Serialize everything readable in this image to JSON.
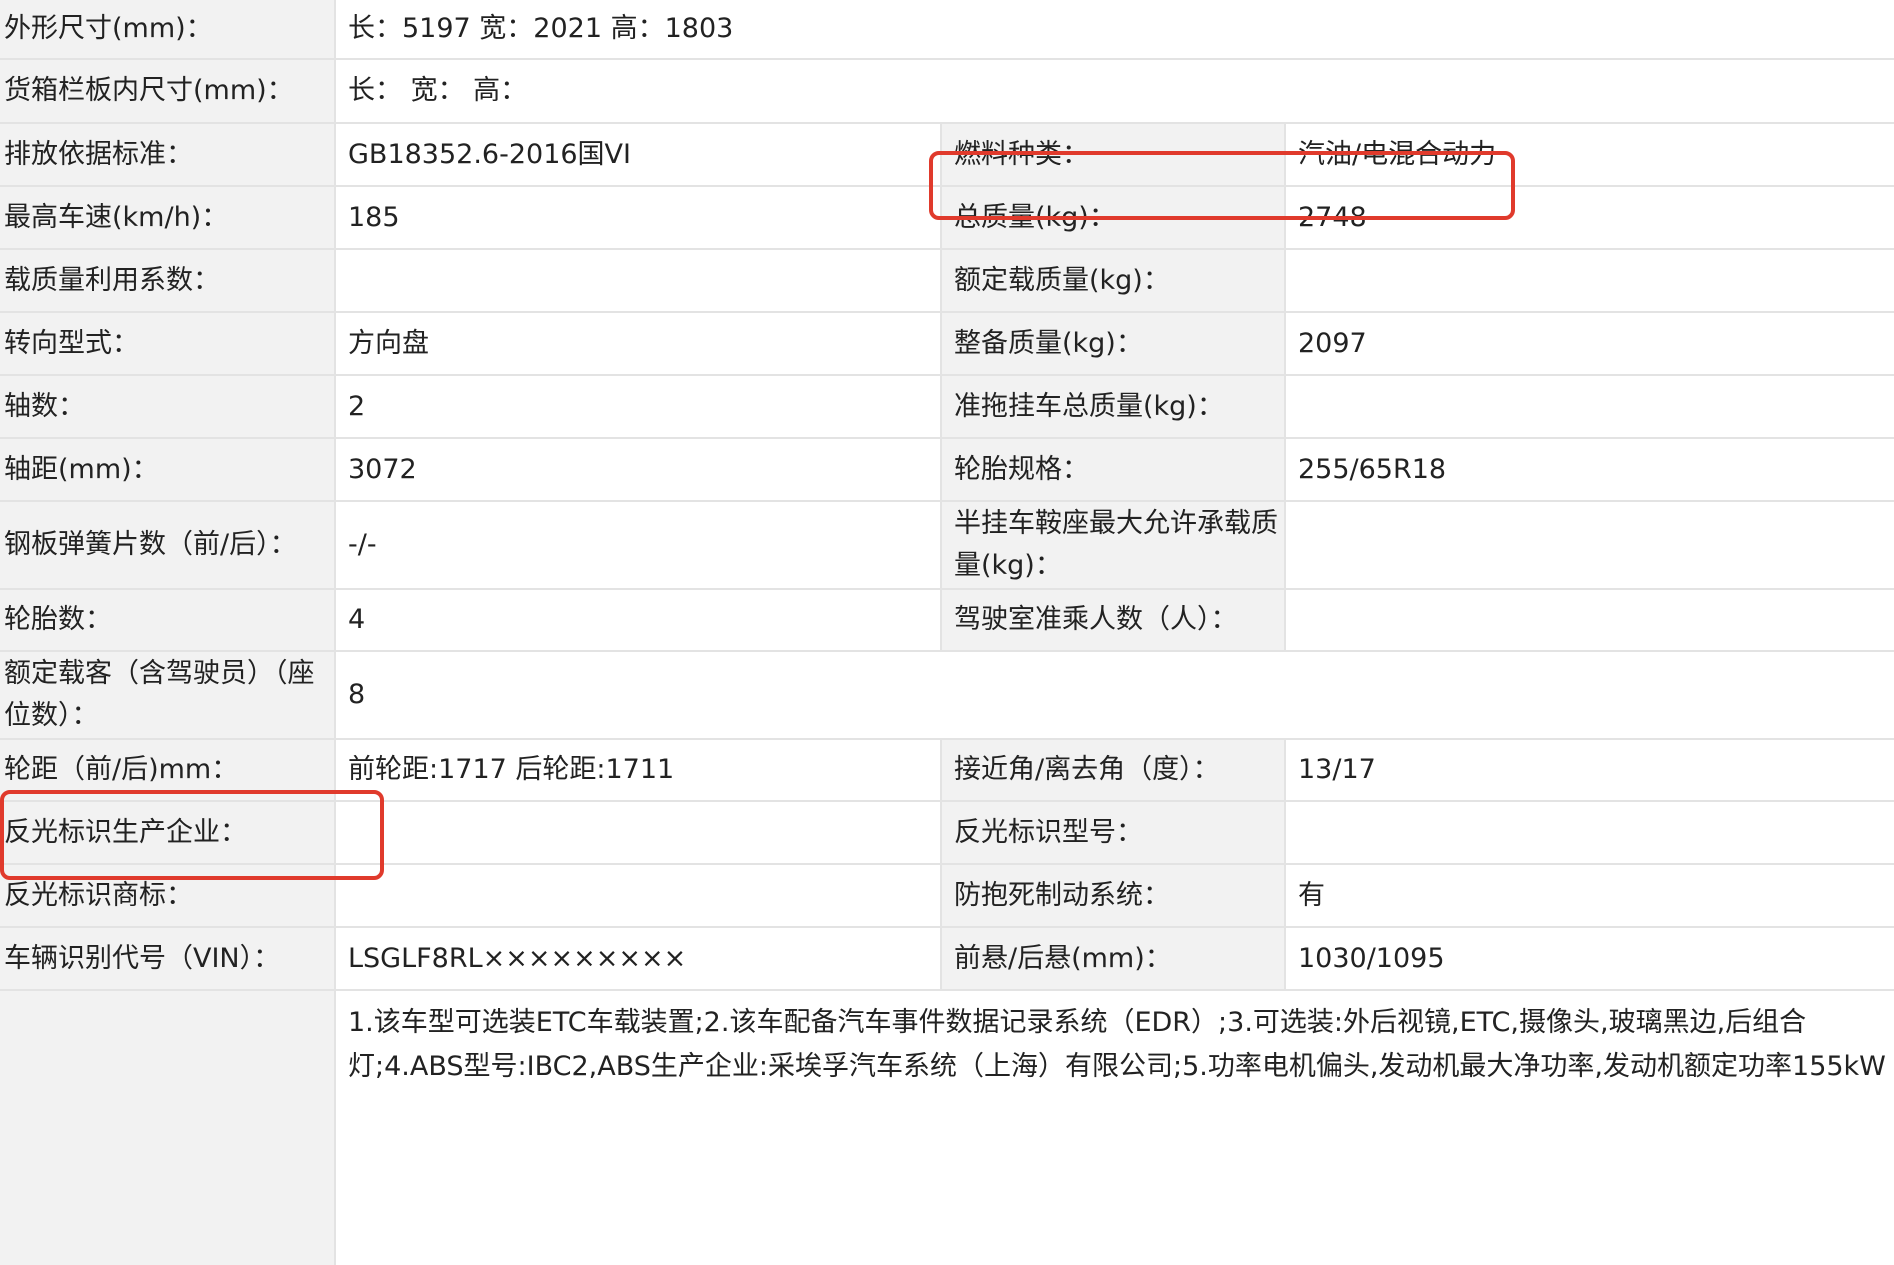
{
  "rows": [
    {
      "l1": "外形尺寸(mm)：",
      "v1": "长：5197 宽：2021 高：1803"
    },
    {
      "l1": "货箱栏板内尺寸(mm)：",
      "v1": "长：  宽：  高："
    },
    {
      "l1": "排放依据标准：",
      "v1": "GB18352.6-2016国VI",
      "l2": "燃料种类：",
      "v2": "汽油/电混合动力"
    },
    {
      "l1": "最高车速(km/h)：",
      "v1": "185",
      "l2": "总质量(kg)：",
      "v2": "2748"
    },
    {
      "l1": "载质量利用系数：",
      "v1": "",
      "l2": "额定载质量(kg)：",
      "v2": ""
    },
    {
      "l1": "转向型式：",
      "v1": "方向盘",
      "l2": "整备质量(kg)：",
      "v2": "2097"
    },
    {
      "l1": "轴数：",
      "v1": "2",
      "l2": "准拖挂车总质量(kg)：",
      "v2": ""
    },
    {
      "l1": "轴距(mm)：",
      "v1": "3072",
      "l2": "轮胎规格：",
      "v2": "255/65R18"
    },
    {
      "l1": "钢板弹簧片数（前/后）：",
      "v1": "-/-",
      "l2": "半挂车鞍座最大允许承载质量(kg)：",
      "v2": ""
    },
    {
      "l1": "轮胎数：",
      "v1": "4",
      "l2": "驾驶室准乘人数（人）：",
      "v2": ""
    },
    {
      "l1": "额定载客（含驾驶员）（座位数）：",
      "v1": "8"
    },
    {
      "l1": "轮距（前/后)mm：",
      "v1": "前轮距:1717 后轮距:1711",
      "l2": "接近角/离去角（度）：",
      "v2": "13/17"
    },
    {
      "l1": "反光标识生产企业：",
      "v1": "",
      "l2": "反光标识型号：",
      "v2": ""
    },
    {
      "l1": "反光标识商标：",
      "v1": "",
      "l2": "防抱死制动系统：",
      "v2": "有"
    },
    {
      "l1": "车辆识别代号（VIN）：",
      "v1": "LSGLF8RL×××××××××",
      "l2": "前悬/后悬(mm)：",
      "v2": "1030/1095"
    }
  ],
  "notes": "1.该车型可选装ETC车载装置;2.该车配备汽车事件数据记录系统（EDR）;3.可选装:外后视镜,ETC,摄像头,玻璃黑边,后组合灯;4.ABS型号:IBC2,ABS生产企业:采埃孚汽车系统（上海）有限公司;5.功率电机偏头,发动机最大净功率,发动机额定功率155kW",
  "highlight_color": "#e03a2c"
}
